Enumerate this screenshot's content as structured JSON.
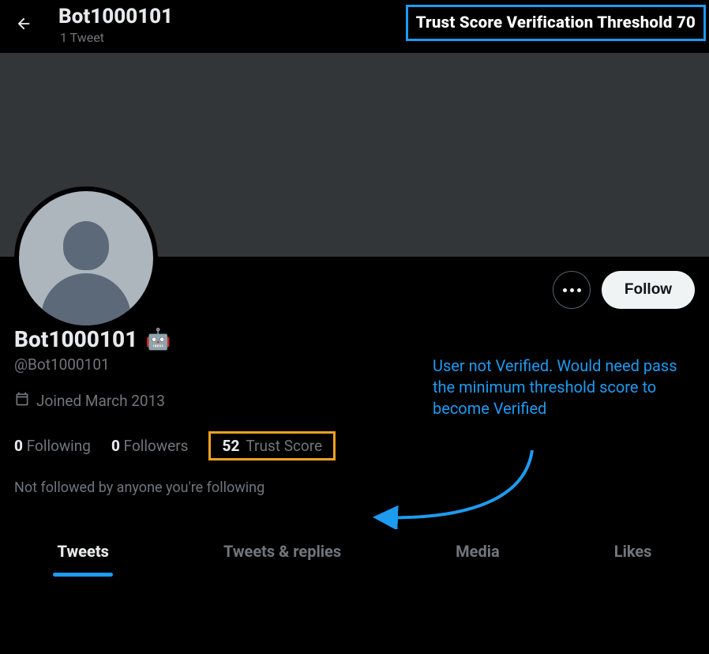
{
  "header": {
    "title": "Bot1000101",
    "subtitle": "1 Tweet"
  },
  "overlay": {
    "threshold_label": "Trust Score Verification Threshold 70",
    "annotation_text": "User not Verified. Would need pass the minimum threshold score to become Verified"
  },
  "actions": {
    "follow_label": "Follow"
  },
  "profile": {
    "display_name": "Bot1000101",
    "emoji": "🤖",
    "handle": "@Bot1000101",
    "joined_label": "Joined March 2013",
    "following_count": "0",
    "following_label": "Following",
    "followers_count": "0",
    "followers_label": "Followers",
    "trust_score_value": "52",
    "trust_score_label": "Trust Score",
    "not_followed_label": "Not followed by anyone you're following"
  },
  "tabs": {
    "tweets": "Tweets",
    "replies": "Tweets & replies",
    "media": "Media",
    "likes": "Likes"
  },
  "colors": {
    "accent": "#1d9bf0",
    "highlight_box": "#f0a020"
  }
}
